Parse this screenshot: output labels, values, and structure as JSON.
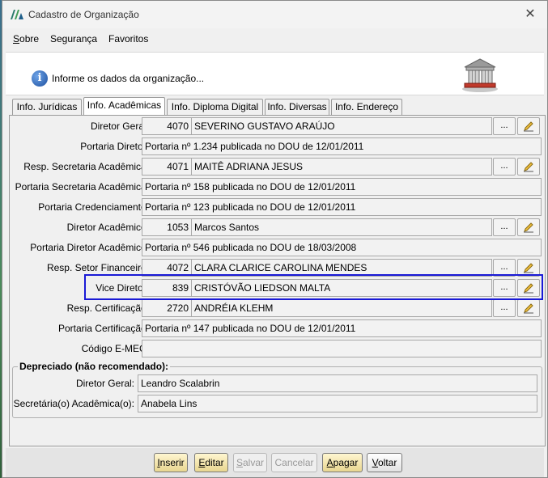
{
  "window": {
    "title": "Cadastro de Organização",
    "close_glyph": "✕"
  },
  "menu": [
    {
      "label": "Sobre",
      "hotkey": "S",
      "rest": "obre"
    },
    {
      "label": "Segurança"
    },
    {
      "label": "Favoritos"
    }
  ],
  "header": {
    "message": "Informe os dados da organização..."
  },
  "tabs": [
    {
      "label": "Info. Jurídicas",
      "active": false
    },
    {
      "label": "Info. Acadêmicas",
      "active": true
    },
    {
      "label": "Info. Diploma Digital",
      "active": false
    },
    {
      "label": "Info. Diversas",
      "active": false
    },
    {
      "label": "Info. Endereço",
      "active": false
    }
  ],
  "form": {
    "diretor_geral": {
      "label": "Diretor Geral:",
      "code": "4070",
      "name": "SEVERINO GUSTAVO ARAÚJO"
    },
    "portaria_diretor": {
      "label": "Portaria Diretor:",
      "value": "Portaria nº 1.234 publicada no DOU de 12/01/2011"
    },
    "resp_secretaria": {
      "label": "Resp. Secretaria Acadêmica:",
      "code": "4071",
      "name": "MAITÊ ADRIANA JESUS"
    },
    "portaria_secretaria": {
      "label": "Portaria Secretaria Acadêmica:",
      "value": "Portaria nº 158 publicada no DOU de 12/01/2011"
    },
    "portaria_credenciamento": {
      "label": "Portaria Credenciamento:",
      "value": "Portaria nº 123 publicada no DOU de 12/01/2011"
    },
    "diretor_academico": {
      "label": "Diretor Acadêmico:",
      "code": "1053",
      "name": "Marcos Santos"
    },
    "portaria_diretor_academico": {
      "label": "Portaria Diretor Acadêmico:",
      "value": "Portaria nº 546 publicada no DOU de 18/03/2008"
    },
    "resp_financeiro": {
      "label": "Resp. Setor Financeiro:",
      "code": "4072",
      "name": "CLARA CLARICE CAROLINA MENDES"
    },
    "vice_diretor": {
      "label": "Vice Diretor:",
      "code": "839",
      "name": "CRISTÓVÃO LIEDSON MALTA"
    },
    "resp_certificacao": {
      "label": "Resp. Certificação:",
      "code": "2720",
      "name": "ANDRÉIA KLEHM"
    },
    "portaria_certificacao": {
      "label": "Portaria Certificação:",
      "value": "Portaria nº 147 publicada no DOU de 12/01/2011"
    },
    "codigo_emec": {
      "label": "Código E-MEC:",
      "value": ""
    },
    "dots": "..."
  },
  "deprecated": {
    "legend": "Depreciado (não recomendado):",
    "diretor_geral": {
      "label": "Diretor Geral:",
      "value": "Leandro Scalabrin"
    },
    "secretaria": {
      "label": "Secretária(o) Acadêmica(o):",
      "value": "Anabela Lins"
    }
  },
  "buttons": {
    "inserir": {
      "hotkey": "I",
      "rest": "nserir"
    },
    "editar": {
      "hotkey": "E",
      "rest": "ditar"
    },
    "salvar": {
      "hotkey": "S",
      "rest": "alvar"
    },
    "cancelar": {
      "label": "Cancelar"
    },
    "apagar": {
      "hotkey": "A",
      "rest": "pagar"
    },
    "voltar": {
      "hotkey": "V",
      "rest": "oltar"
    }
  },
  "colors": {
    "highlight": "#1a1ad6",
    "button_enabled": "#f0e3a8"
  }
}
